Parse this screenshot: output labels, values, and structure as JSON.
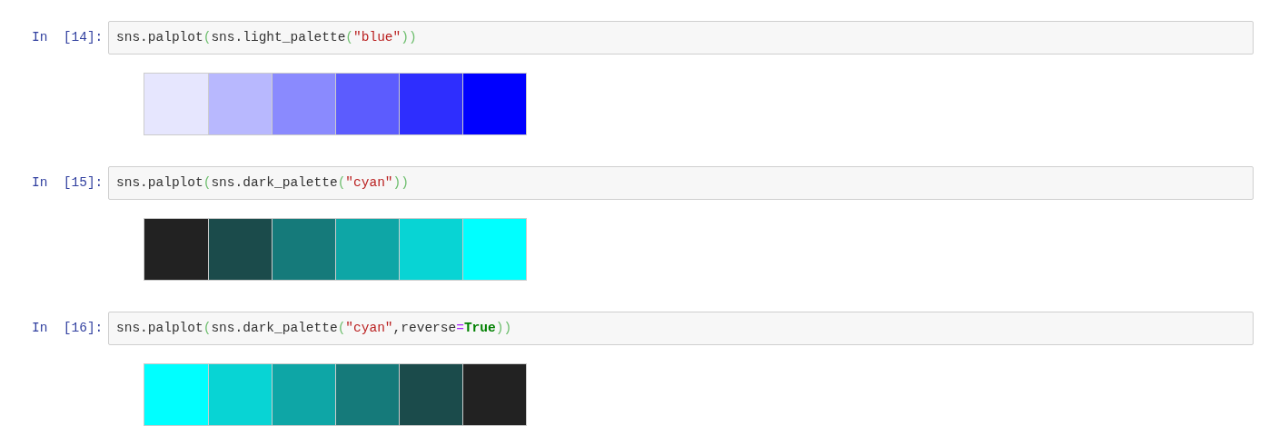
{
  "cells": [
    {
      "prompt": "In  [14]:",
      "code": [
        {
          "kind": "plain",
          "text": "sns.palplot"
        },
        {
          "kind": "paren",
          "text": "("
        },
        {
          "kind": "plain",
          "text": "sns.light_palette"
        },
        {
          "kind": "paren",
          "text": "("
        },
        {
          "kind": "string",
          "text": "\"blue\""
        },
        {
          "kind": "paren",
          "text": "))"
        }
      ],
      "swatches": [
        {
          "color": "#e6e6fe"
        },
        {
          "color": "#b8b8fe"
        },
        {
          "color": "#8a8afe"
        },
        {
          "color": "#5c5cfe"
        },
        {
          "color": "#2e2efe"
        },
        {
          "color": "#0000ff"
        }
      ]
    },
    {
      "prompt": "In  [15]:",
      "code": [
        {
          "kind": "plain",
          "text": "sns.palplot"
        },
        {
          "kind": "paren",
          "text": "("
        },
        {
          "kind": "plain",
          "text": "sns.dark_palette"
        },
        {
          "kind": "paren",
          "text": "("
        },
        {
          "kind": "string",
          "text": "\"cyan\""
        },
        {
          "kind": "paren",
          "text": "))"
        }
      ],
      "swatches": [
        {
          "color": "#222222"
        },
        {
          "color": "#1b4b4b"
        },
        {
          "color": "#157a7a"
        },
        {
          "color": "#0ea6a6"
        },
        {
          "color": "#08d4d4"
        },
        {
          "color": "#00ffff"
        }
      ]
    },
    {
      "prompt": "In  [16]:",
      "code": [
        {
          "kind": "plain",
          "text": "sns.palplot"
        },
        {
          "kind": "paren",
          "text": "("
        },
        {
          "kind": "plain",
          "text": "sns.dark_palette"
        },
        {
          "kind": "paren",
          "text": "("
        },
        {
          "kind": "string",
          "text": "\"cyan\""
        },
        {
          "kind": "plain",
          "text": ",reverse"
        },
        {
          "kind": "operator",
          "text": "="
        },
        {
          "kind": "keyword",
          "text": "True"
        },
        {
          "kind": "paren",
          "text": "))"
        }
      ],
      "swatches": [
        {
          "color": "#00ffff"
        },
        {
          "color": "#08d4d4"
        },
        {
          "color": "#0ea6a6"
        },
        {
          "color": "#157a7a"
        },
        {
          "color": "#1b4b4b"
        },
        {
          "color": "#222222"
        }
      ]
    }
  ]
}
